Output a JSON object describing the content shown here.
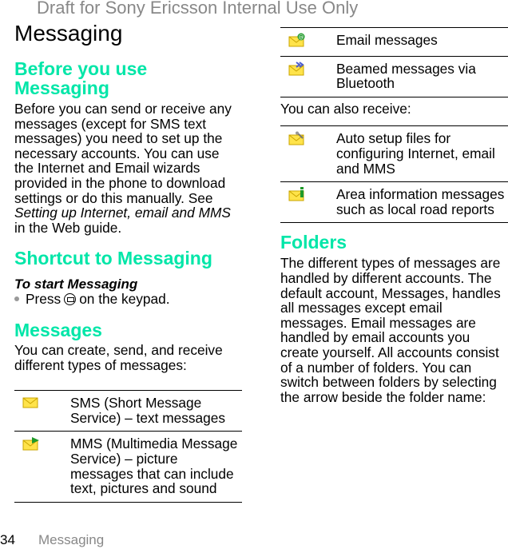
{
  "header": {
    "watermark": "Draft for Sony Ericsson Internal Use Only",
    "title": "Messaging"
  },
  "colors": {
    "heading": "#00e6a8",
    "watermark": "#888888"
  },
  "left": {
    "before": {
      "heading": "Before you use Messaging",
      "text_pre": "Before you can send or receive any messages (except for SMS text messages) you need to set up the necessary accounts. You can use the Internet and Email wizards provided in the phone to download settings or do this manually. See ",
      "text_link": "Setting up Internet, email and MMS",
      "text_post": " in the Web guide."
    },
    "shortcut": {
      "heading": "Shortcut to Messaging",
      "subheading": "To start Messaging",
      "step_pre": "Press",
      "step_icon": "messaging-key-icon",
      "step_post": "on the keypad."
    },
    "messages": {
      "heading": "Messages",
      "text": "You can create, send, and receive different types of messages:"
    },
    "types": [
      {
        "icon": "sms-envelope-icon",
        "text": "SMS (Short Message Service) – text messages"
      },
      {
        "icon": "mms-envelope-icon",
        "text": "MMS (Multimedia Message Service) – picture messages that can include text, pictures and sound"
      }
    ]
  },
  "right": {
    "types": [
      {
        "icon": "email-envelope-icon",
        "text": "Email messages"
      },
      {
        "icon": "bluetooth-envelope-icon",
        "text": "Beamed messages via Bluetooth"
      }
    ],
    "also_receive": "You can also receive:",
    "receive": [
      {
        "icon": "auto-setup-envelope-icon",
        "text": "Auto setup files for configuring Internet, email and MMS"
      },
      {
        "icon": "area-info-envelope-icon",
        "text": "Area information messages such as local road reports"
      }
    ],
    "folders": {
      "heading": "Folders",
      "text": "The different types of messages are handled by different accounts. The default account, Messages, handles all messages except email messages. Email messages are handled by email accounts you create yourself. All accounts consist of a number of folders. You can switch between folders by selecting the arrow beside the folder name:"
    }
  },
  "footer": {
    "page_number": "34",
    "section": "Messaging"
  }
}
